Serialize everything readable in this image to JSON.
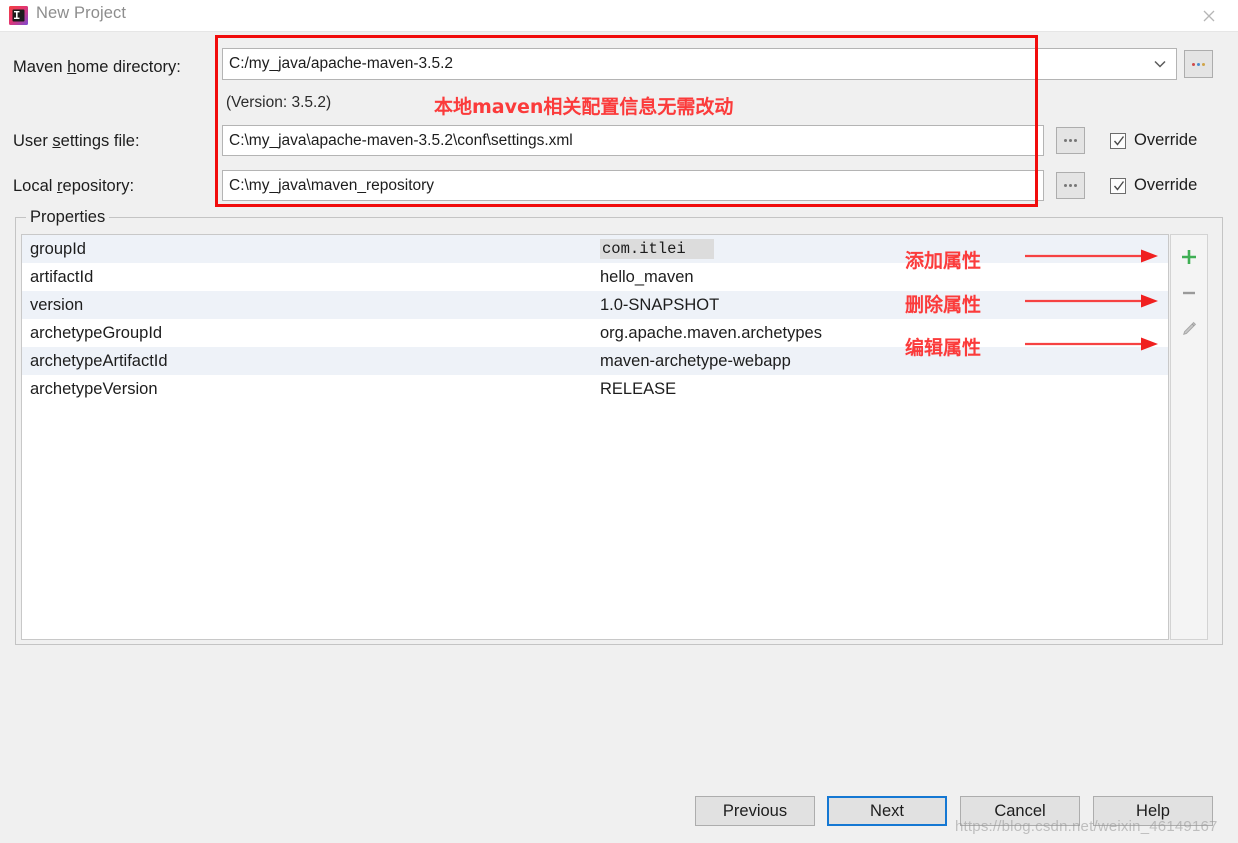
{
  "window": {
    "title": "New Project",
    "app_icon": "intellij-idea-icon",
    "close_icon": "close-icon"
  },
  "form": {
    "maven_home": {
      "label_pre": "Maven ",
      "label_mnemonic": "h",
      "label_post": "ome directory:",
      "value": "C:/my_java/apache-maven-3.5.2",
      "browse_label": "…"
    },
    "version_note": "(Version: 3.5.2)",
    "user_settings": {
      "label_pre": "User ",
      "label_mnemonic": "s",
      "label_post": "ettings file:",
      "value": "C:\\my_java\\apache-maven-3.5.2\\conf\\settings.xml",
      "override_label": "Override",
      "override_checked": true
    },
    "local_repository": {
      "label_pre": "Local ",
      "label_mnemonic": "r",
      "label_post": "epository:",
      "value": "C:\\my_java\\maven_repository",
      "override_label": "Override",
      "override_checked": true
    }
  },
  "annotations": {
    "rect_color": "#f10c0c",
    "text_color": "#fb3b3b",
    "top_note": "本地maven相关配置信息无需改动",
    "add_property": "添加属性",
    "delete_property": "删除属性",
    "edit_property": "编辑属性"
  },
  "properties": {
    "legend": "Properties",
    "rows": [
      {
        "key": "groupId",
        "value": "com.itlei",
        "editing": true
      },
      {
        "key": "artifactId",
        "value": "hello_maven",
        "editing": false
      },
      {
        "key": "version",
        "value": "1.0-SNAPSHOT",
        "editing": false
      },
      {
        "key": "archetypeGroupId",
        "value": "org.apache.maven.archetypes",
        "editing": false
      },
      {
        "key": "archetypeArtifactId",
        "value": "maven-archetype-webapp",
        "editing": false
      },
      {
        "key": "archetypeVersion",
        "value": "RELEASE",
        "editing": false
      }
    ],
    "toolbar": {
      "add_icon": "plus-icon",
      "remove_icon": "minus-icon",
      "edit_icon": "pencil-icon",
      "add_color": "#3faf54",
      "remove_color": "#9a9a9a",
      "edit_color": "#a8a8a8"
    }
  },
  "buttons": {
    "previous": "Previous",
    "next": "Next",
    "cancel": "Cancel",
    "help": "Help",
    "default_accent": "#1578d3"
  },
  "watermark": "https://blog.csdn.net/weixin_46149167"
}
